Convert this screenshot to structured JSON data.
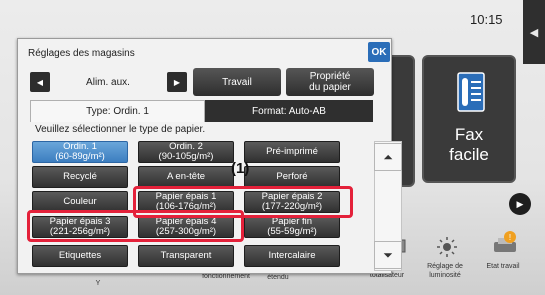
{
  "status": {
    "clock": "10:15"
  },
  "dialog": {
    "title": "Réglages des magasins",
    "ok_label": "OK",
    "tray_name": "Alim. aux.",
    "travail_label": "Travail",
    "propriete_label": "Propriété\ndu papier",
    "tab_type": "Type: Ordin. 1",
    "tab_format": "Format: Auto-AB",
    "instruction": "Veuillez sélectionner le type de papier."
  },
  "paper_types": [
    {
      "label": "Ordin. 1\n(60-89g/m²)",
      "selected": true
    },
    {
      "label": "Ordin. 2\n(90-105g/m²)",
      "selected": false
    },
    {
      "label": "Pré-imprimé",
      "selected": false
    },
    {
      "label": "Recyclé",
      "selected": false
    },
    {
      "label": "A en-tête",
      "selected": false
    },
    {
      "label": "Perforé",
      "selected": false
    },
    {
      "label": "Couleur",
      "selected": false
    },
    {
      "label": "Papier épais 1\n(106-176g/m²)",
      "selected": false
    },
    {
      "label": "Papier épais 2\n(177-220g/m²)",
      "selected": false
    },
    {
      "label": "Papier épais 3\n(221-256g/m²)",
      "selected": false
    },
    {
      "label": "Papier épais 4\n(257-300g/m²)",
      "selected": false
    },
    {
      "label": "Papier fin\n(55-59g/m²)",
      "selected": false
    },
    {
      "label": "Etiquettes",
      "selected": false
    },
    {
      "label": "Transparent",
      "selected": false
    },
    {
      "label": "Intercalaire",
      "selected": false
    }
  ],
  "callout": "(1)",
  "background": {
    "fax_label": "Fax\nfacile",
    "label_fonct": "fonctionnement",
    "label_affich": "affichage\nétendu",
    "label_compteur": "pteur\ntotalisateur",
    "label_reglage": "Réglage de\nluminosité",
    "label_etat": "Etat travail",
    "label_y": "Y"
  },
  "colors": {
    "selected": "#3c7ec0",
    "highlight": "#e4213a",
    "ok": "#2a6db8"
  }
}
